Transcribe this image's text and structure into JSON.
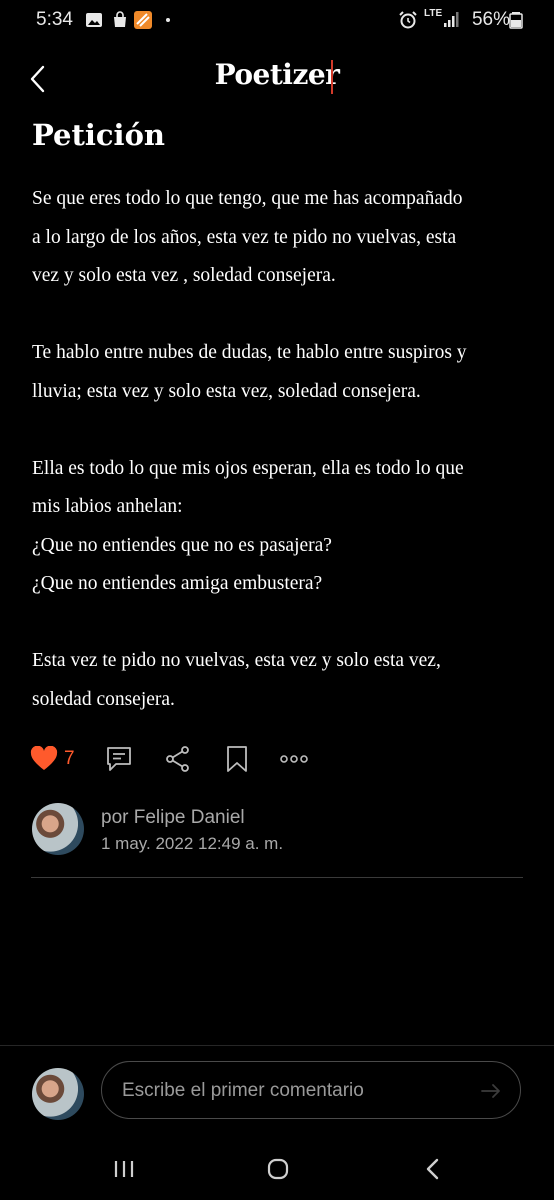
{
  "status_bar": {
    "time": "5:34",
    "network": "LTE",
    "battery": "56%"
  },
  "header": {
    "title": "Poetizer"
  },
  "poem": {
    "title": "Petición",
    "stanzas": [
      [
        "Se que eres todo lo que tengo, que me has acompañado",
        "a lo largo de los años, esta vez te pido no vuelvas,  esta",
        "vez y solo esta vez , soledad consejera."
      ],
      [
        "Te hablo entre nubes de dudas, te hablo entre suspiros y",
        "lluvia; esta vez y solo esta vez,  soledad consejera."
      ],
      [
        "Ella es todo lo que mis ojos esperan, ella es todo lo que",
        "mis labios anhelan:",
        "¿Que no entiendes que no es pasajera?",
        "¿Que no entiendes amiga embustera?"
      ],
      [
        "Esta vez te pido no vuelvas,  esta vez y solo esta vez,",
        "soledad consejera."
      ]
    ]
  },
  "actions": {
    "likes": "7"
  },
  "author": {
    "name": "por Felipe Daniel",
    "date": "1 may. 2022 12:49 a. m."
  },
  "comment": {
    "placeholder": "Escribe el primer comentario"
  },
  "colors": {
    "accent": "#ff5a2c",
    "background": "#000000"
  }
}
